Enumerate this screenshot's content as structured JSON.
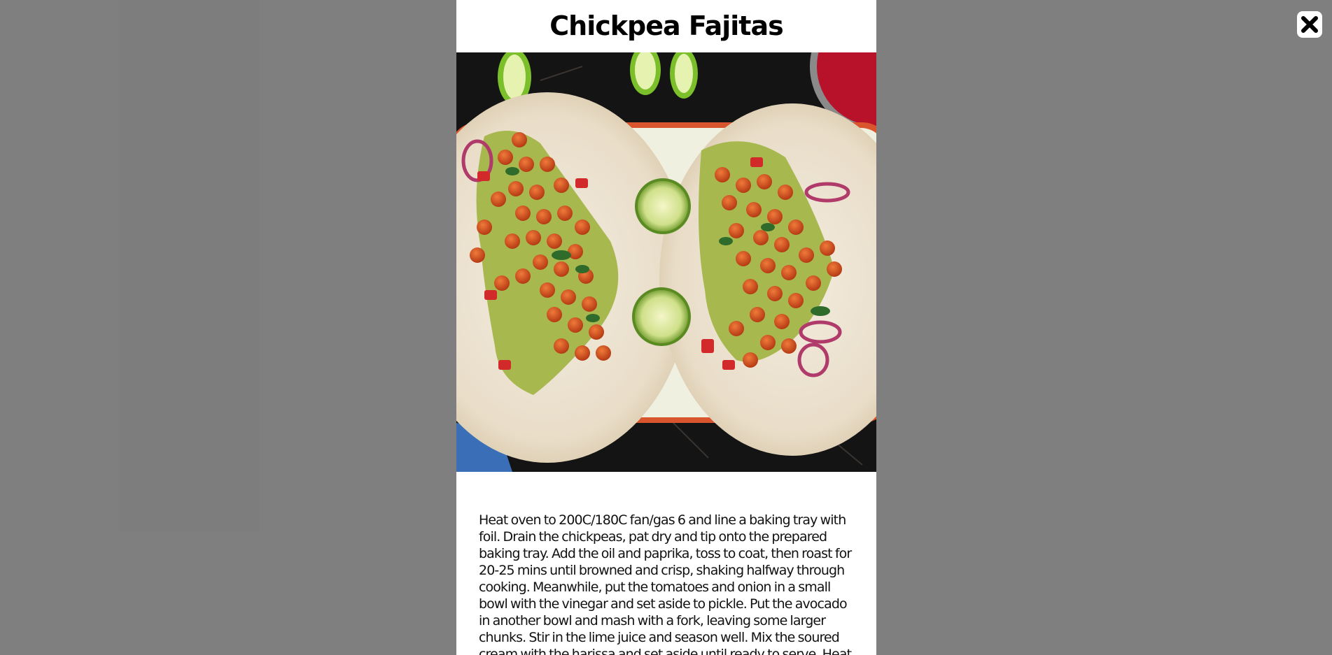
{
  "modal": {
    "title": "Chickpea Fajitas",
    "image_icon": "recipe-photo",
    "method": "Heat oven to 200C/180C fan/gas 6 and line a baking tray with foil. Drain the chickpeas, pat dry and tip onto the prepared baking tray. Add the oil and paprika, toss to coat, then roast for 20-25 mins until browned and crisp, shaking halfway through cooking. Meanwhile, put the tomatoes and onion in a small bowl with the vinegar and set aside to pickle. Put the avocado in another bowl and mash with a fork, leaving some larger chunks. Stir in the lime juice and season well. Mix the soured cream with the harissa and set aside until ready to serve. Heat"
  },
  "close": {
    "icon": "close-icon"
  },
  "colors": {
    "overlay": "#7f7f7f",
    "modal_bg": "#ffffff",
    "text": "#111111"
  }
}
